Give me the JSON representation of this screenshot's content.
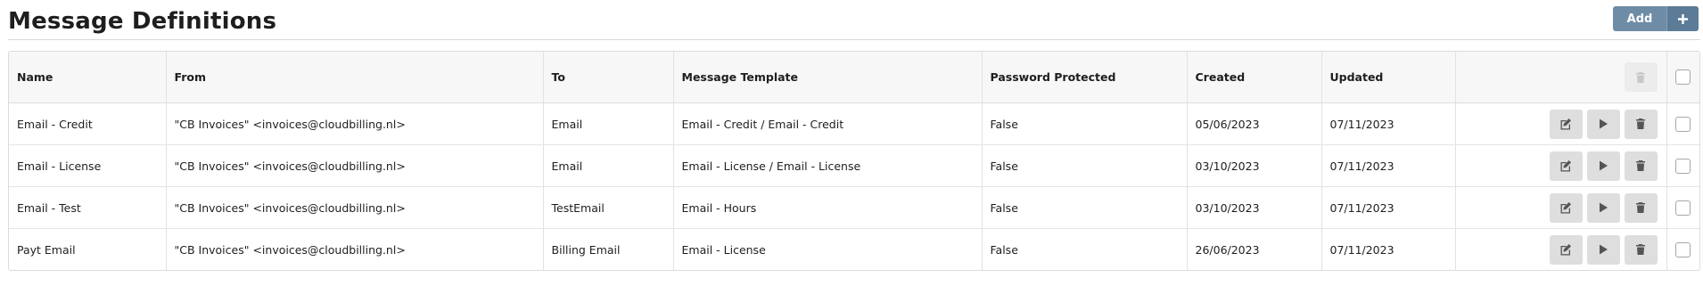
{
  "page": {
    "title": "Message Definitions",
    "add_label": "Add",
    "plus_icon": "plus-icon"
  },
  "table": {
    "columns": [
      "Name",
      "From",
      "To",
      "Message Template",
      "Password Protected",
      "Created",
      "Updated"
    ],
    "rows": [
      {
        "name": "Email - Credit",
        "from": "\"CB Invoices\" <invoices@cloudbilling.nl>",
        "to": "Email",
        "template": "Email - Credit / Email - Credit",
        "password_protected": "False",
        "created": "05/06/2023",
        "updated": "07/11/2023"
      },
      {
        "name": "Email - License",
        "from": "\"CB Invoices\" <invoices@cloudbilling.nl>",
        "to": "Email",
        "template": "Email - License / Email - License",
        "password_protected": "False",
        "created": "03/10/2023",
        "updated": "07/11/2023"
      },
      {
        "name": "Email - Test",
        "from": "\"CB Invoices\" <invoices@cloudbilling.nl>",
        "to": "TestEmail",
        "template": "Email - Hours",
        "password_protected": "False",
        "created": "03/10/2023",
        "updated": "07/11/2023"
      },
      {
        "name": "Payt Email",
        "from": "\"CB Invoices\" <invoices@cloudbilling.nl>",
        "to": "Billing Email",
        "template": "Email - License",
        "password_protected": "False",
        "created": "26/06/2023",
        "updated": "07/11/2023"
      }
    ],
    "row_action_icons": [
      "edit-icon",
      "play-icon",
      "trash-icon"
    ],
    "header_action_icon": "trash-icon"
  },
  "colors": {
    "add_button": "#6e8ca5",
    "plus_button": "#5c7b96",
    "action_button": "#dedede",
    "header_bg": "#f7f7f8"
  }
}
